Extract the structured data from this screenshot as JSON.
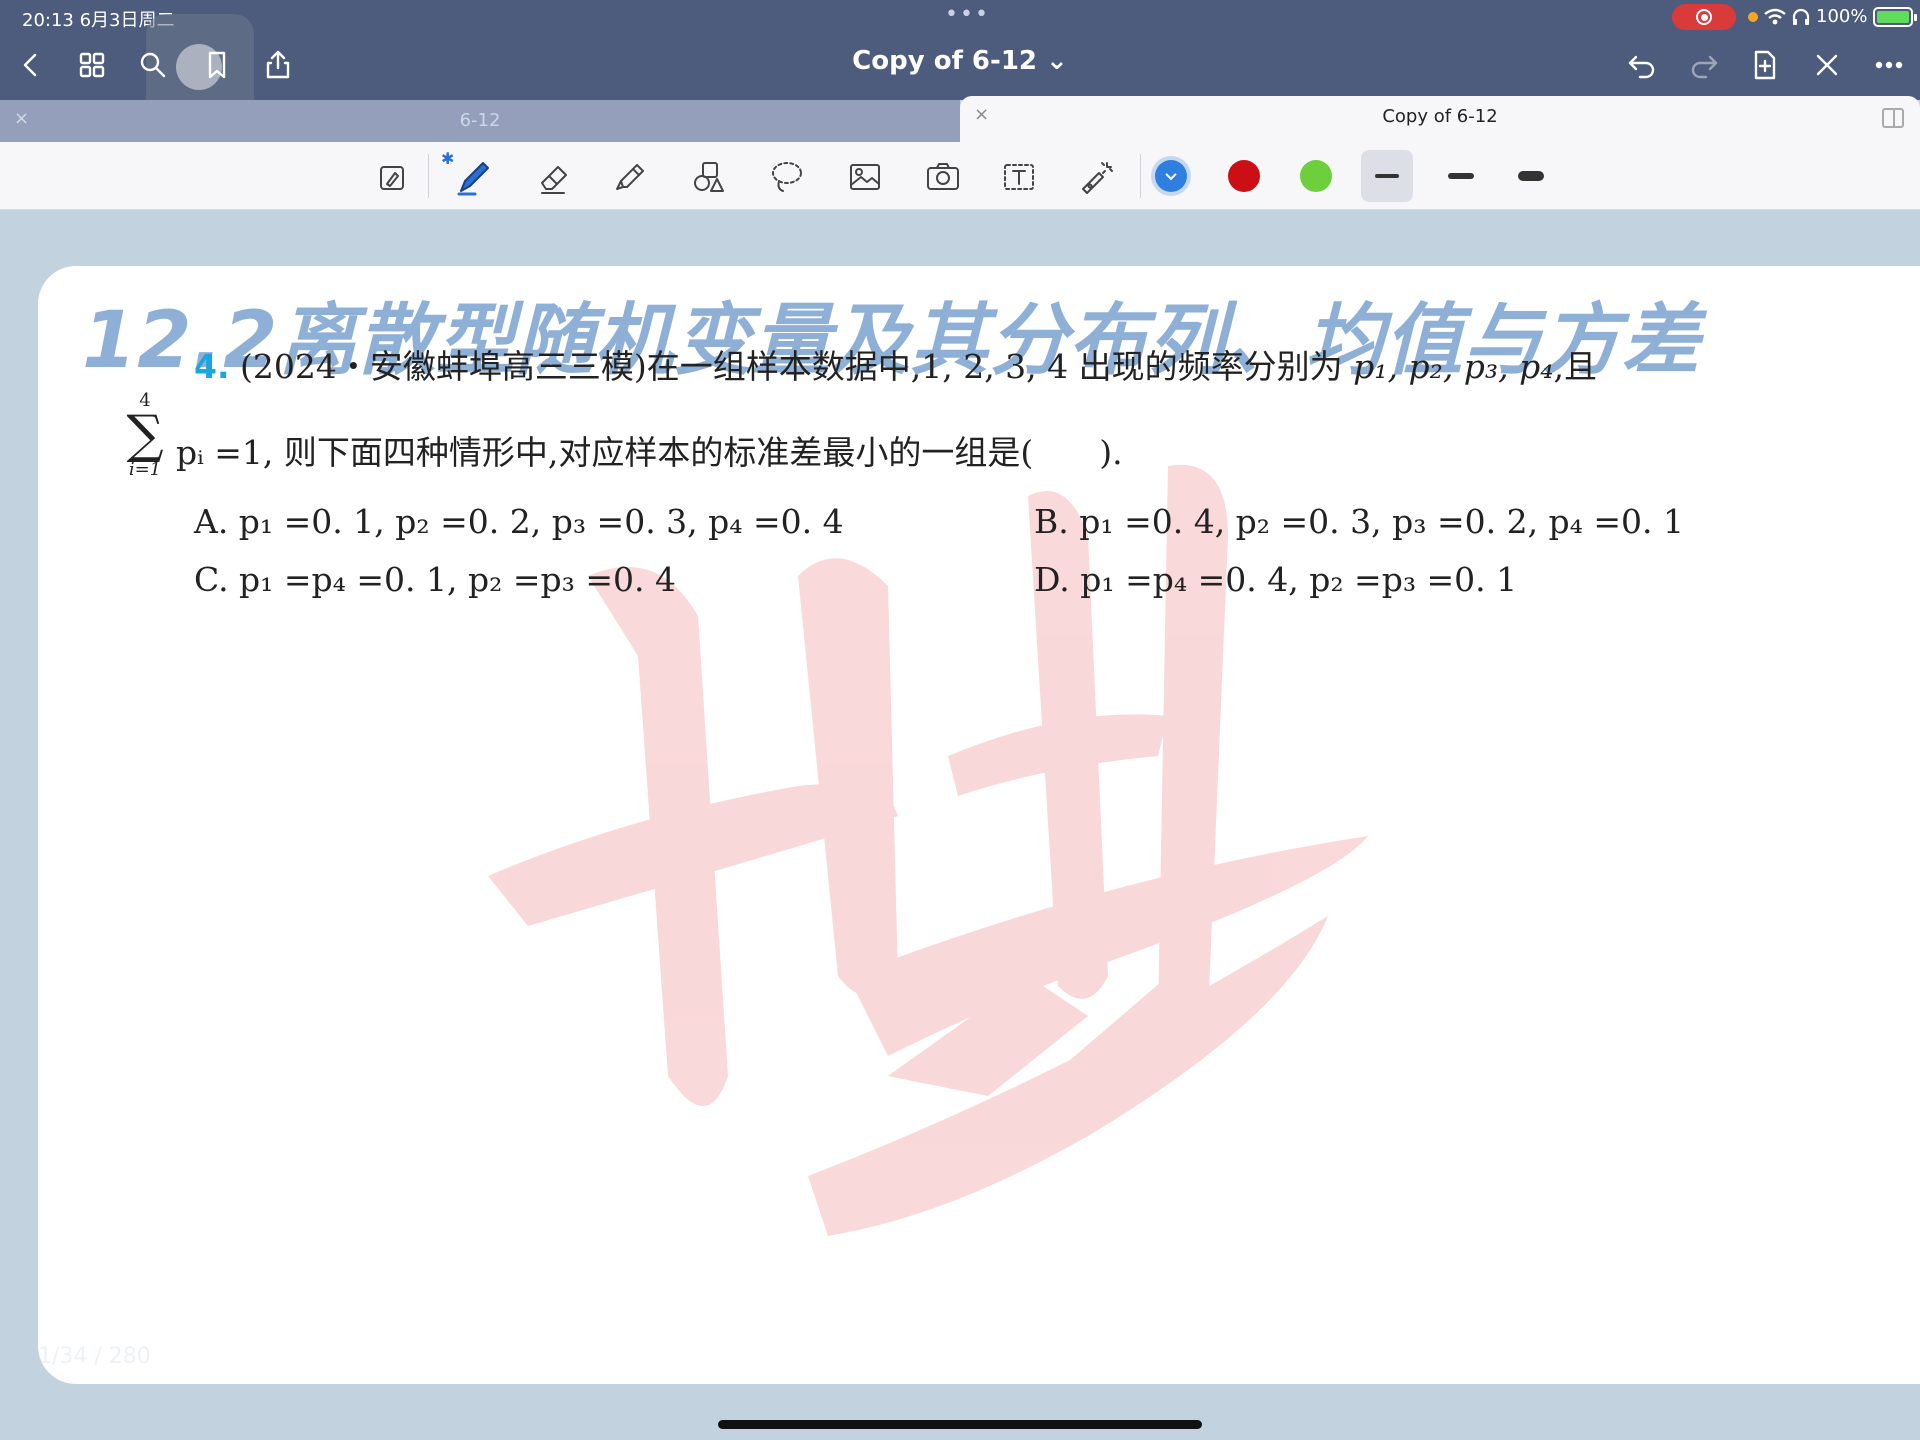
{
  "status_bar": {
    "time_date": "20:13  6月3日周二",
    "battery_text": "100%"
  },
  "nav": {
    "title": "Copy of 6-12 ⌄"
  },
  "tabs": [
    {
      "label": "6-12",
      "active": false
    },
    {
      "label": "Copy of 6-12",
      "active": true
    }
  ],
  "toolbar": {
    "colors": [
      "#2f7fe0",
      "#cc0e15",
      "#6dcf3c"
    ],
    "selected_color": "#2f7fe0"
  },
  "document": {
    "heading": "12.2离散型随机变量及其分布列、均值与方差",
    "question": {
      "number": "4.",
      "line1": "(2024・安徽蚌埠高三三模)在一组样本数据中,1, 2, 3, 4 出现的频率分别为",
      "line1_vars": "p₁, p₂, p₃, p₄",
      "line1_end": ",且",
      "sum_top": "4",
      "sum_sigma": "∑",
      "sum_bottom": "i=1",
      "line2": "pᵢ =1, 则下面四种情形中,对应样本的标准差最小的一组是(　　).",
      "options": {
        "A": "A.  p₁ =0. 1, p₂ =0. 2, p₃ =0. 3, p₄ =0. 4",
        "B": "B.  p₁ =0. 4, p₂ =0. 3, p₃ =0. 2, p₄ =0. 1",
        "C": "C.  p₁ =p₄ =0. 1, p₂ =p₃ =0. 4",
        "D": "D.  p₁ =p₄ =0. 4, p₂ =p₃ =0. 1"
      }
    },
    "page_indicator": "1/34 / 280"
  }
}
